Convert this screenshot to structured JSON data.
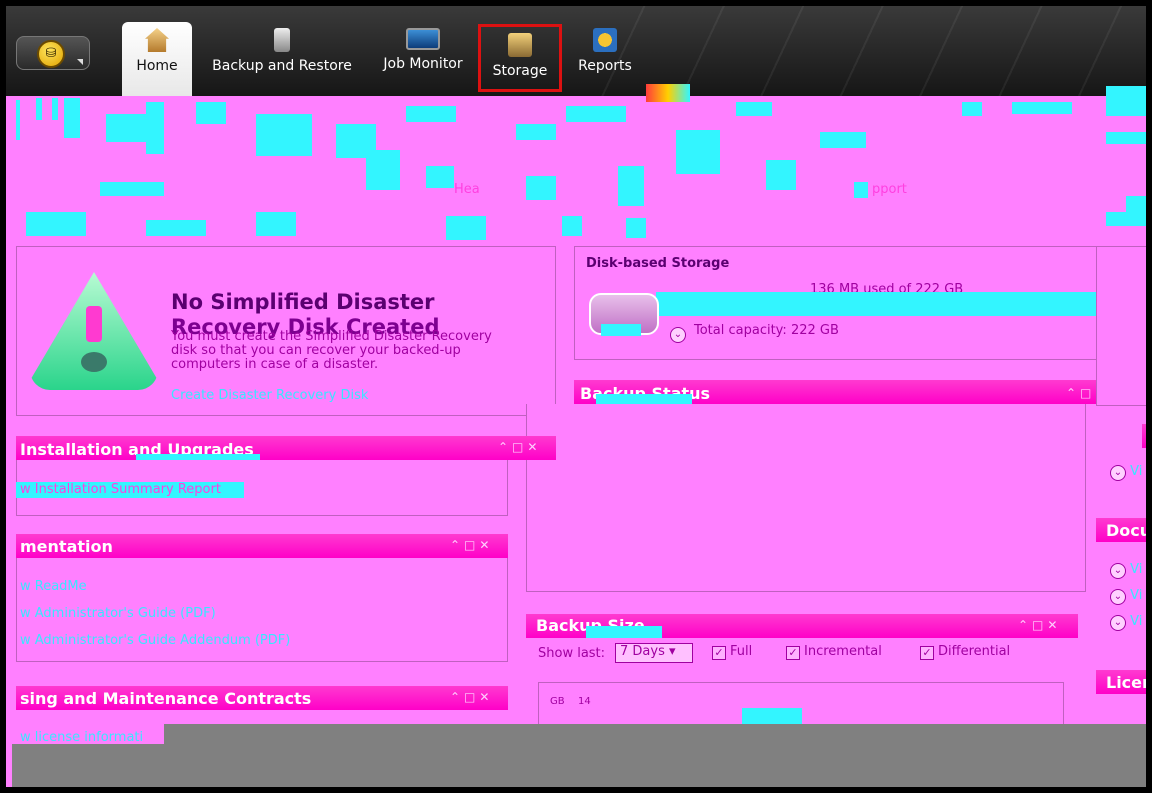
{
  "ribbon": {
    "app_menu_icon": "database-coin-icon",
    "tabs": [
      {
        "label": "Home",
        "icon": "house-icon"
      },
      {
        "label": "Backup and Restore",
        "icon": "server-icon"
      },
      {
        "label": "Job Monitor",
        "icon": "monitor-icon"
      },
      {
        "label": "Storage",
        "icon": "storage-icon"
      },
      {
        "label": "Reports",
        "icon": "reports-icon"
      }
    ]
  },
  "alert": {
    "title_line1": "No Simplified Disaster",
    "title_line2": "Recovery Disk Created",
    "body": "You must create the Simplified Disaster Recovery disk so that you can recover your backed-up computers in case of a disaster.",
    "link": "Create Disaster Recovery Disk",
    "icon": "warning-triangle-icon"
  },
  "disk_storage": {
    "title": "Disk-based Storage",
    "usage": "136 MB used of 222 GB",
    "capacity": "Total capacity: 222 GB"
  },
  "backup_status": {
    "title": "Backup Status"
  },
  "installation": {
    "title": "Installation and Upgrades",
    "link": "w Installation Summary Report"
  },
  "documentation": {
    "title": "mentation",
    "links": [
      "w ReadMe",
      "w Administrator's Guide (PDF)",
      "w Administrator's Guide Addendum (PDF)"
    ]
  },
  "licensing": {
    "title": "sing and Maintenance Contracts",
    "link": "w license informati"
  },
  "backup_size": {
    "title": "Backup Size",
    "show_last_label": "Show last:",
    "period": "7 Days",
    "checks": [
      {
        "label": "Full",
        "checked": true
      },
      {
        "label": "Incremental",
        "checked": true
      },
      {
        "label": "Differential",
        "checked": true
      }
    ],
    "y_unit": "GB",
    "y_tick": "14"
  },
  "right_column": {
    "docu_title": "Docu",
    "licen_title": "Licen",
    "view_links": [
      "Vi",
      "Vi",
      "Vi",
      "Vi"
    ]
  },
  "garbled": {
    "support": "pport",
    "health": "Hea"
  }
}
